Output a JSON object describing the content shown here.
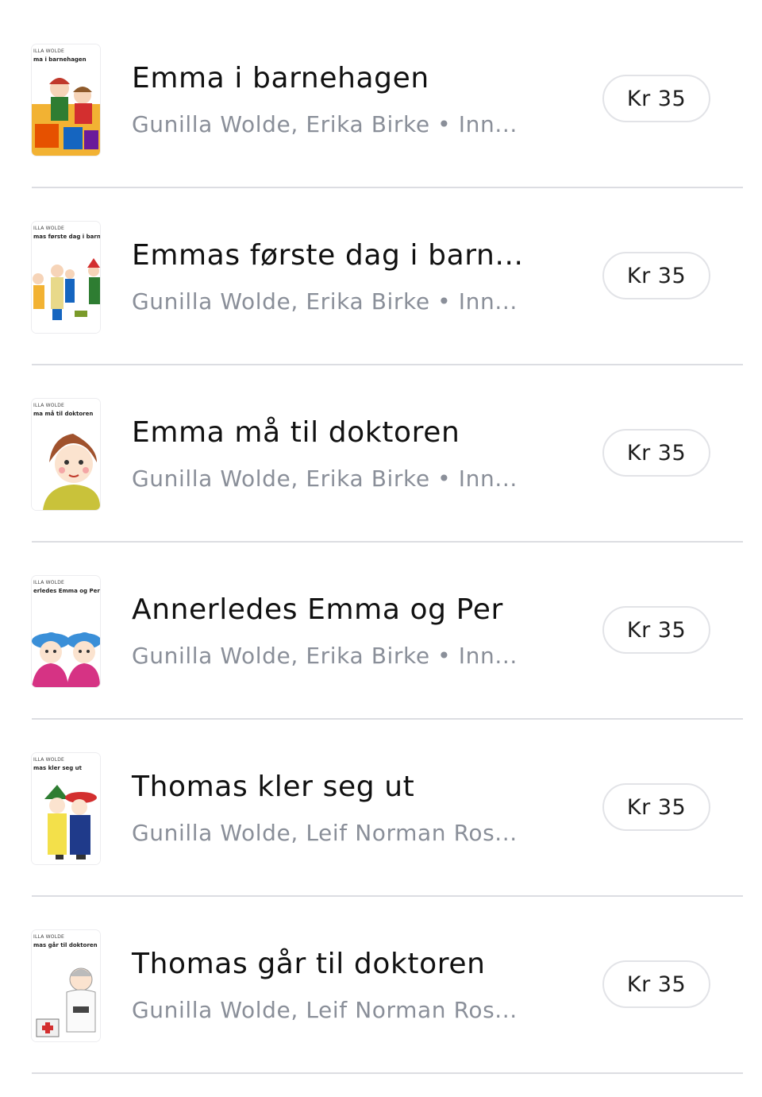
{
  "books": [
    {
      "title": "Emma i barnehagen",
      "subtitle": "Gunilla Wolde, Erika Birke • Inn...",
      "price": "Kr 35",
      "cover_author": "ILLA WOLDE",
      "cover_title": "ma i barnehagen"
    },
    {
      "title": "Emmas første dag i barn...",
      "subtitle": "Gunilla Wolde, Erika Birke • Inn...",
      "price": "Kr 35",
      "cover_author": "ILLA WOLDE",
      "cover_title": "mas første dag i barnel"
    },
    {
      "title": "Emma må til doktoren",
      "subtitle": "Gunilla Wolde, Erika Birke • Inn...",
      "price": "Kr 35",
      "cover_author": "ILLA WOLDE",
      "cover_title": "ma må til doktoren"
    },
    {
      "title": "Annerledes Emma og Per",
      "subtitle": "Gunilla Wolde, Erika Birke • Inn...",
      "price": "Kr 35",
      "cover_author": "ILLA WOLDE",
      "cover_title": "erledes Emma og Per"
    },
    {
      "title": "Thomas kler seg ut",
      "subtitle": "Gunilla Wolde, Leif Norman Ros...",
      "price": "Kr 35",
      "cover_author": "ILLA WOLDE",
      "cover_title": "mas kler seg ut"
    },
    {
      "title": "Thomas går til doktoren",
      "subtitle": "Gunilla Wolde, Leif Norman Ros...",
      "price": "Kr 35",
      "cover_author": "ILLA WOLDE",
      "cover_title": "mas går til doktoren"
    }
  ]
}
